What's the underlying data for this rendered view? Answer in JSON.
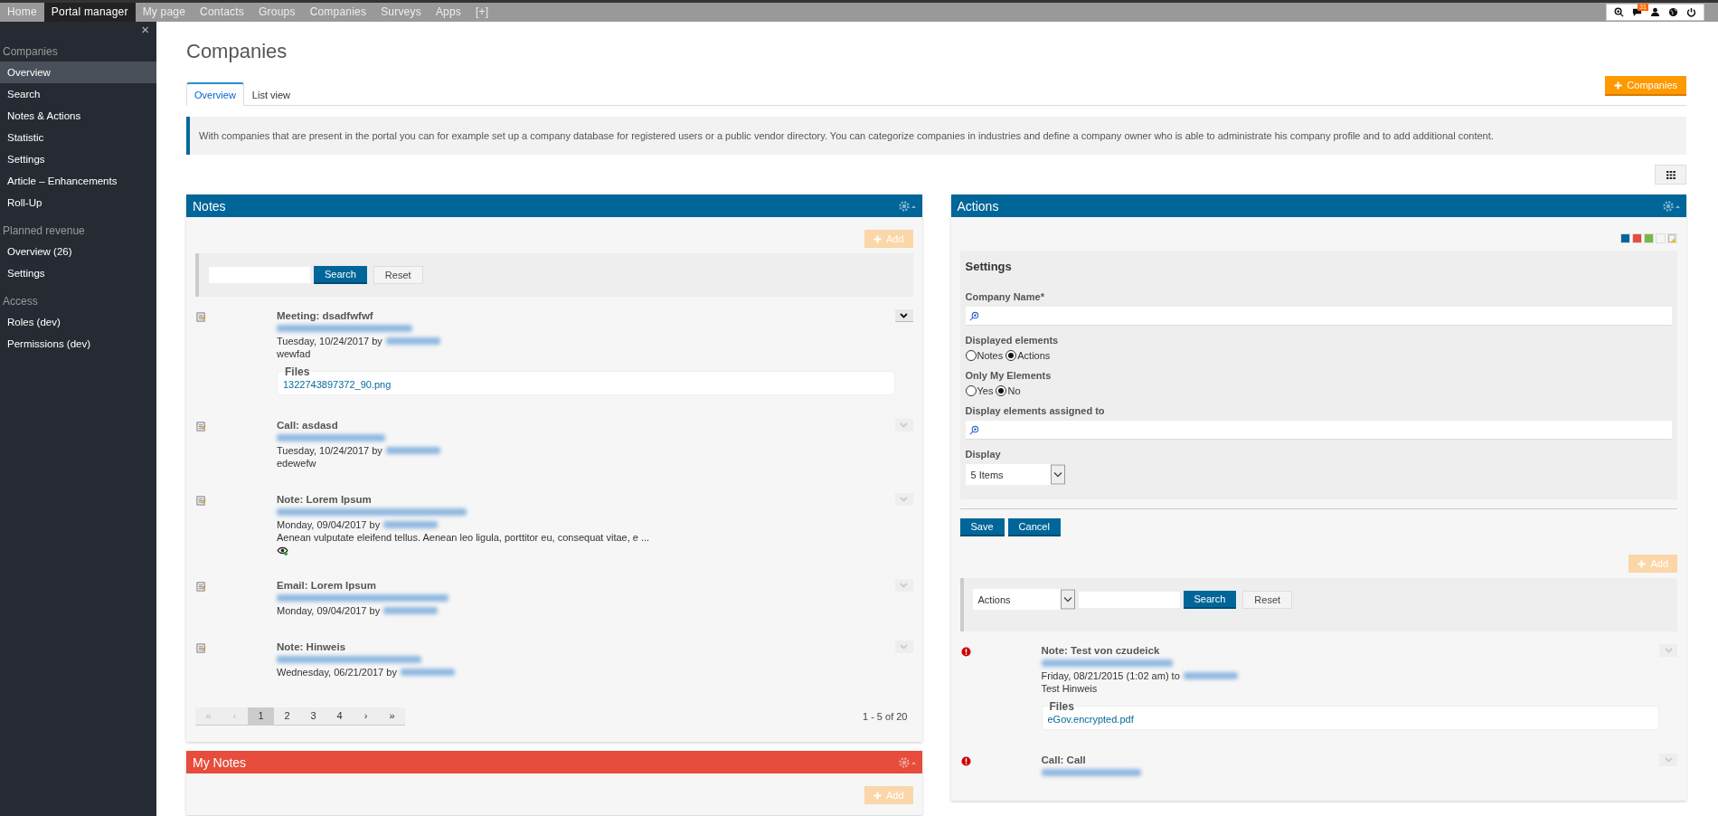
{
  "top_nav": {
    "items": [
      {
        "label": "Home",
        "selected": false
      },
      {
        "label": "Portal manager",
        "selected": true
      },
      {
        "label": "My page",
        "selected": false
      },
      {
        "label": "Contacts",
        "selected": false
      },
      {
        "label": "Groups",
        "selected": false
      },
      {
        "label": "Companies",
        "selected": false
      },
      {
        "label": "Surveys",
        "selected": false
      },
      {
        "label": "Apps",
        "selected": false
      },
      {
        "label": "[+]",
        "selected": false
      }
    ],
    "message_count": "31"
  },
  "sidebar": {
    "close": "×",
    "sections": [
      {
        "title": "Companies",
        "items": [
          {
            "label": "Overview",
            "selected": true
          },
          {
            "label": "Search",
            "selected": false
          },
          {
            "label": "Notes & Actions",
            "selected": false
          },
          {
            "label": "Statistic",
            "selected": false
          },
          {
            "label": "Settings",
            "selected": false
          },
          {
            "label": "Article – Enhancements",
            "selected": false
          },
          {
            "label": "Roll-Up",
            "selected": false
          }
        ]
      },
      {
        "title": "Planned revenue",
        "items": [
          {
            "label": "Overview (26)",
            "selected": false
          },
          {
            "label": "Settings",
            "selected": false
          }
        ]
      },
      {
        "title": "Access",
        "items": [
          {
            "label": "Roles (dev)",
            "selected": false
          },
          {
            "label": "Permissions (dev)",
            "selected": false
          }
        ]
      }
    ]
  },
  "page": {
    "title": "Companies",
    "tabs": [
      {
        "label": "Overview",
        "selected": true
      },
      {
        "label": "List view",
        "selected": false
      }
    ],
    "add_button": "Companies",
    "info": "With companies that are present in the portal you can for example set up a company database for registered users or a public vendor directory. You can categorize companies in industries and define a company owner who is able to administrate his company profile and to add additional content."
  },
  "notes_panel": {
    "title": "Notes",
    "color": "#006699",
    "add_button": "Add",
    "search_button": "Search",
    "reset_button": "Reset",
    "items": [
      {
        "kind": "note",
        "title": "Meeting: dsadfwfwf",
        "date": "Tuesday, 10/24/2017 by",
        "text": "wewfad",
        "files_label": "Files",
        "files": [
          "1322743897372_90.png"
        ],
        "viewed": false,
        "expanded": true
      },
      {
        "kind": "note",
        "title": "Call: asdasd",
        "date": "Tuesday, 10/24/2017 by",
        "text": "edewefw",
        "viewed": false,
        "expanded": false
      },
      {
        "kind": "note",
        "title": "Note: Lorem Ipsum",
        "date": "Monday, 09/04/2017 by",
        "text": "Aenean vulputate eleifend tellus. Aenean leo ligula, porttitor eu, consequat vitae, e ...",
        "viewed": true,
        "expanded": false
      },
      {
        "kind": "note",
        "title": "Email: Lorem Ipsum",
        "date": "Monday, 09/04/2017 by",
        "viewed": false,
        "expanded": false
      },
      {
        "kind": "note",
        "title": "Note: Hinweis",
        "date": "Wednesday, 06/21/2017 by",
        "viewed": false,
        "expanded": false
      }
    ],
    "pager": [
      {
        "label": "«",
        "selected": false,
        "disabled": true
      },
      {
        "label": "‹",
        "selected": false,
        "disabled": true
      },
      {
        "label": "1",
        "selected": true,
        "disabled": false
      },
      {
        "label": "2",
        "selected": false,
        "disabled": false
      },
      {
        "label": "3",
        "selected": false,
        "disabled": false
      },
      {
        "label": "4",
        "selected": false,
        "disabled": false
      },
      {
        "label": "›",
        "selected": false,
        "disabled": false
      },
      {
        "label": "»",
        "selected": false,
        "disabled": false
      }
    ],
    "count": "1 - 5 of 20"
  },
  "my_notes_panel": {
    "title": "My Notes",
    "color": "#e74c3c",
    "add_button": "Add"
  },
  "actions_panel": {
    "title": "Actions",
    "color": "#006699",
    "swatches": [
      {
        "color": "#006699"
      },
      {
        "color": "#e74c3c"
      },
      {
        "color": "#7ab648"
      },
      {
        "color": "#f5f5f5"
      }
    ],
    "settings": {
      "title": "Settings",
      "company_label": "Company Name*",
      "displayed_label": "Displayed elements",
      "displayed_options": [
        {
          "label": "Notes",
          "selected": false
        },
        {
          "label": "Actions",
          "selected": true
        }
      ],
      "only_mine_label": "Only My Elements",
      "only_mine_options": [
        {
          "label": "Yes",
          "selected": false
        },
        {
          "label": "No",
          "selected": true
        }
      ],
      "assigned_label": "Display elements assigned to",
      "display_label": "Display",
      "display_value": "5 Items"
    },
    "save_button": "Save",
    "cancel_button": "Cancel",
    "add_button": "Add",
    "filter_value": "Actions",
    "search_button": "Search",
    "reset_button": "Reset",
    "items": [
      {
        "kind": "alert",
        "title": "Note: Test von czudeick",
        "date": "Friday, 08/21/2015 (1:02 am) to",
        "text": "Test Hinweis",
        "files_label": "Files",
        "files": [
          "eGov.encrypted.pdf"
        ],
        "viewed": false,
        "expanded": false
      },
      {
        "kind": "alert",
        "title": "Call: Call",
        "viewed": false,
        "expanded": false
      }
    ]
  }
}
